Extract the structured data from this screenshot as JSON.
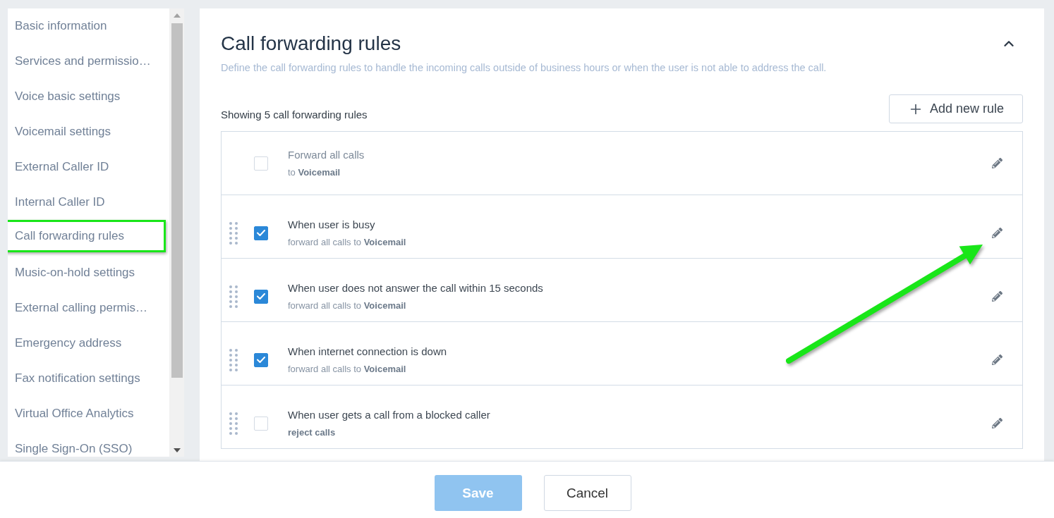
{
  "sidebar": {
    "items": [
      {
        "label": "Basic information",
        "selected": false
      },
      {
        "label": "Services and permissio…",
        "selected": false
      },
      {
        "label": "Voice basic settings",
        "selected": false
      },
      {
        "label": "Voicemail settings",
        "selected": false
      },
      {
        "label": "External Caller ID",
        "selected": false
      },
      {
        "label": "Internal Caller ID",
        "selected": false
      },
      {
        "label": "Call forwarding rules",
        "selected": true
      },
      {
        "label": "Music-on-hold settings",
        "selected": false
      },
      {
        "label": "External calling permis…",
        "selected": false
      },
      {
        "label": "Emergency address",
        "selected": false
      },
      {
        "label": "Fax notification settings",
        "selected": false
      },
      {
        "label": "Virtual Office Analytics",
        "selected": false
      },
      {
        "label": "Single Sign-On (SSO)",
        "selected": false
      }
    ]
  },
  "panel": {
    "title": "Call forwarding rules",
    "expanded": true,
    "description": "Define the call forwarding rules to handle the incoming calls outside of business hours or when the user is not able to address the call.",
    "count_text": "Showing 5 call forwarding rules",
    "add_button": "Add new rule"
  },
  "rules": [
    {
      "kind": "always",
      "checked": false,
      "title": "Forward all calls",
      "detail": "to **Voicemail**",
      "detail_bold": false
    },
    {
      "kind": "conditional",
      "checked": true,
      "title": "When user is busy",
      "detail": "forward all calls to **Voicemail**",
      "detail_bold": false
    },
    {
      "kind": "conditional",
      "checked": true,
      "title": "When user does not answer the call within 15 seconds",
      "detail": "forward all calls to **Voicemail**",
      "detail_bold": false
    },
    {
      "kind": "conditional",
      "checked": true,
      "title": "When internet connection is down",
      "detail": "forward all calls to **Voicemail**",
      "detail_bold": false
    },
    {
      "kind": "conditional",
      "checked": false,
      "title": "When user gets a call from a blocked caller",
      "detail": "reject calls",
      "detail_bold": true
    }
  ],
  "footer": {
    "buttons": [
      {
        "kind": "primary",
        "label": "Save",
        "disabled": true
      },
      {
        "kind": "secondary",
        "label": "Cancel",
        "disabled": false
      }
    ]
  }
}
